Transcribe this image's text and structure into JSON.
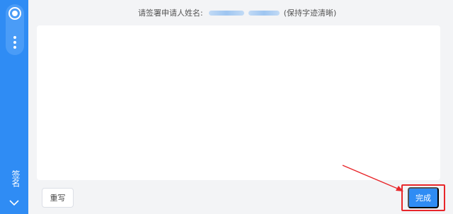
{
  "sidebar": {
    "target_icon": "target-icon",
    "more_icon": "more-vertical-icon",
    "sign_label": "签名",
    "collapse_icon": "chevron-down-icon"
  },
  "header": {
    "prefix": "请签署申请人姓名:",
    "suffix": "(保持字迹清晰)"
  },
  "actions": {
    "reset_label": "重写",
    "done_label": "完成"
  },
  "colors": {
    "accent": "#2f8cf4",
    "annotation": "#e8262a"
  }
}
